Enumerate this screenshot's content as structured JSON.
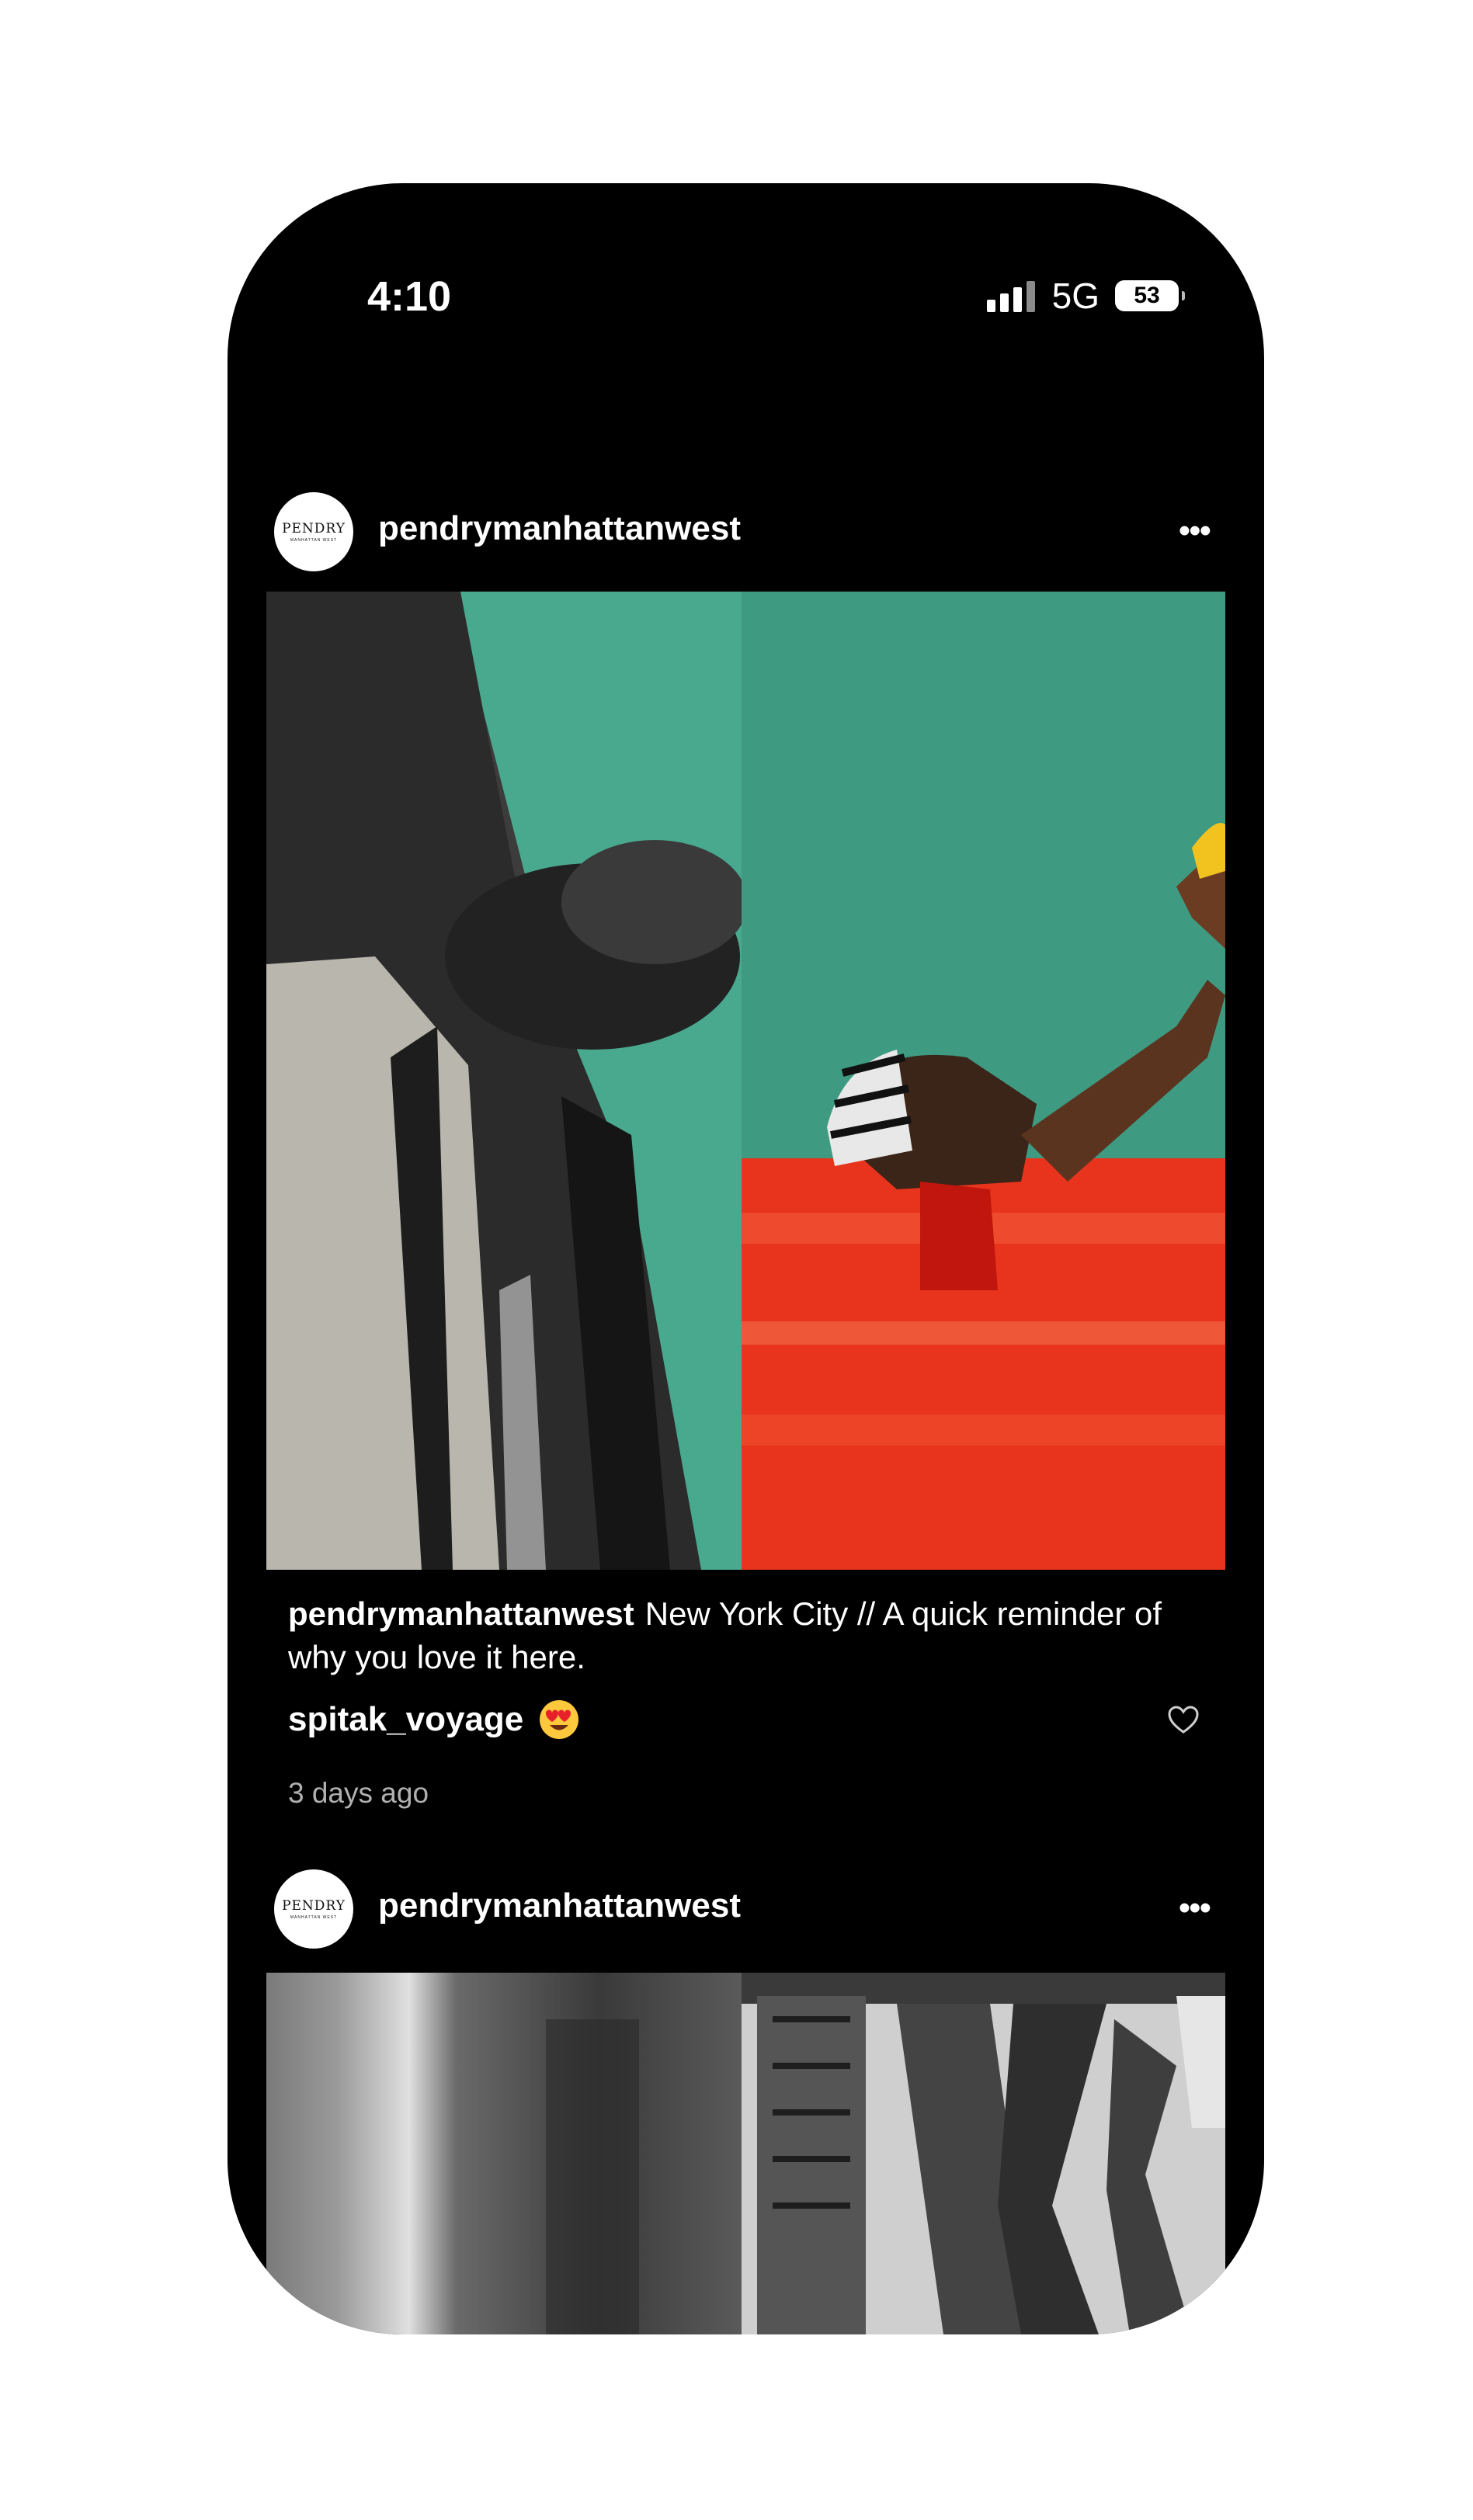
{
  "status_bar": {
    "time": "4:10",
    "network": "5G",
    "battery": "53"
  },
  "posts": [
    {
      "avatar_logo": "PENDRY",
      "avatar_logo_sub": "MANHATTAN WEST",
      "username": "pendrymanhattanwest",
      "more_icon": "more-horizontal-icon",
      "caption_user": "pendrymanhattanwest",
      "caption_text": "New York City // A quick reminder of why you love it here.",
      "comment_user": "spitak_voyage",
      "comment_emoji": "heart-eyes-emoji",
      "like_icon": "heart-outline-icon",
      "time_ago": "3 days ago"
    },
    {
      "avatar_logo": "PENDRY",
      "avatar_logo_sub": "MANHATTAN WEST",
      "username": "pendrymanhattanwest",
      "more_icon": "more-horizontal-icon"
    }
  ],
  "colors": {
    "background": "#000000",
    "teal": "#3f9a82",
    "red": "#e8341c"
  }
}
